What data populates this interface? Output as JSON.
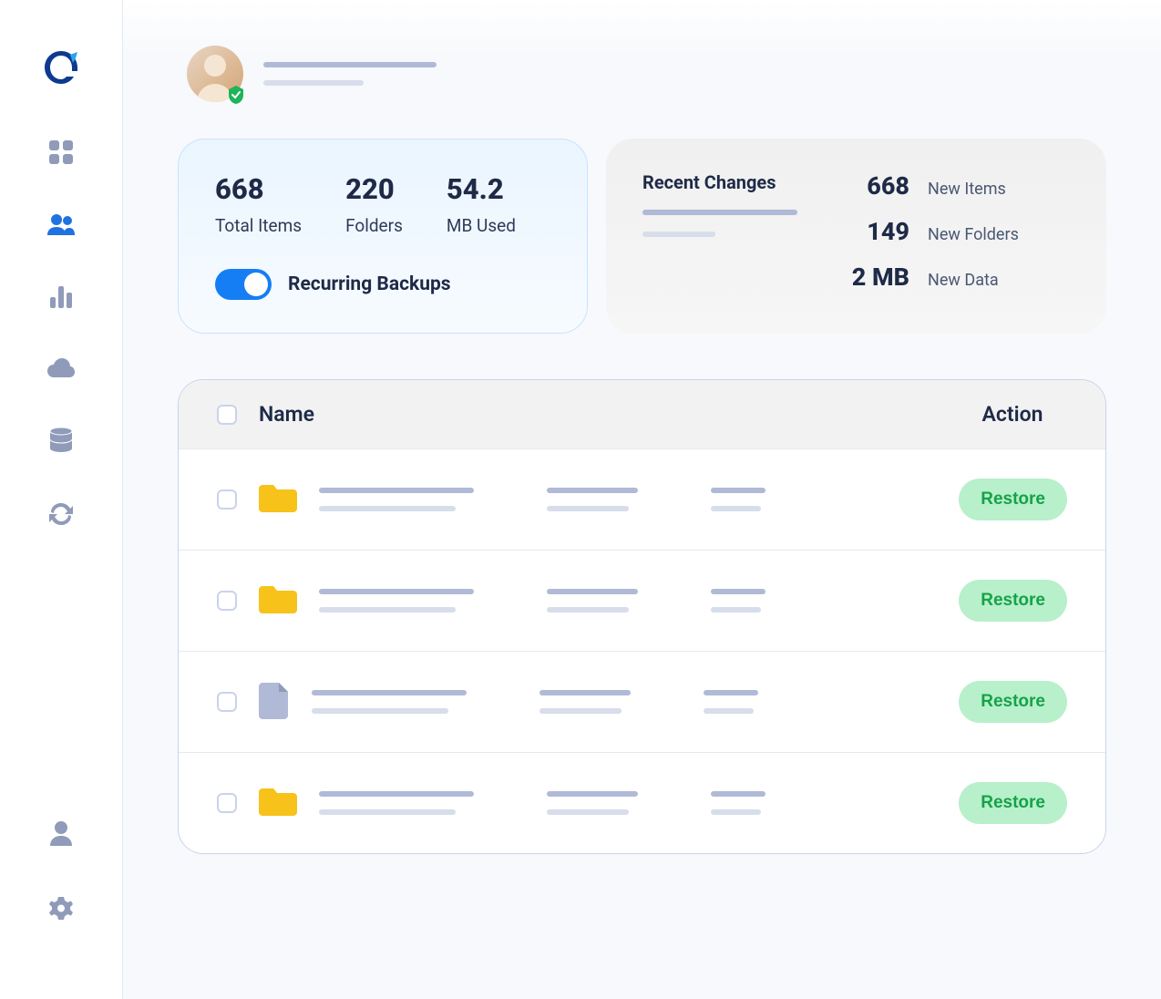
{
  "stats": {
    "total_items": {
      "value": "668",
      "label": "Total Items"
    },
    "folders": {
      "value": "220",
      "label": "Folders"
    },
    "storage": {
      "value": "54.2",
      "label": "MB Used"
    }
  },
  "toggle": {
    "label": "Recurring Backups",
    "state": "on"
  },
  "recent": {
    "title": "Recent Changes",
    "items": [
      {
        "value": "668",
        "label": "New Items"
      },
      {
        "value": "149",
        "label": "New Folders"
      },
      {
        "value": "2 MB",
        "label": "New Data"
      }
    ]
  },
  "table": {
    "header_name": "Name",
    "header_action": "Action",
    "rows": [
      {
        "type": "folder",
        "action": "Restore"
      },
      {
        "type": "folder",
        "action": "Restore"
      },
      {
        "type": "file",
        "action": "Restore"
      },
      {
        "type": "folder",
        "action": "Restore"
      }
    ]
  },
  "nav": {
    "items": [
      "dashboard",
      "users",
      "analytics",
      "cloud",
      "database",
      "sync"
    ],
    "bottom": [
      "profile",
      "settings"
    ]
  }
}
